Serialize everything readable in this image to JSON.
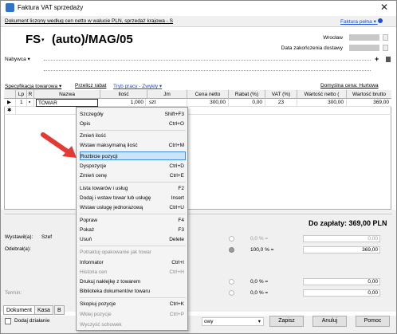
{
  "window": {
    "title": "Faktura VAT sprzedaży"
  },
  "subbar": {
    "doc_type": "Dokument liczony według cen netto w walucie PLN, sprzedaż krajowa - S",
    "full_invoice": "Faktura pełna"
  },
  "header": {
    "series": "FS",
    "number": "(auto)/MAG/05",
    "issue_place_label": "Wrocław",
    "delivery_date_label": "Data zakończenia dostawy",
    "buyer_label": "Nabywca"
  },
  "toolbar": {
    "spec": "Specyfikacja towarowa",
    "discount": "Przelicz rabat",
    "mode": "Tryb pracy - Zwykły",
    "default_price": "Domyślna cena: Hurtowa"
  },
  "grid": {
    "columns": [
      "Lp",
      "R",
      "Nazwa",
      "Ilość",
      "Jm",
      "Cena netto",
      "Rabat (%)",
      "VAT (%)",
      "Wartość netto (",
      "Wartość brutto"
    ],
    "row": {
      "nazwa": "TOWAR",
      "ilosc": "1,000",
      "jm": "szt",
      "cena": "300,00",
      "rabat": "0,00",
      "vat": "23",
      "netto": "300,00",
      "brutto": "369,00"
    }
  },
  "totals": {
    "to_pay": "Do zapłaty: 369,00 PLN"
  },
  "lower": {
    "issued_label": "Wystawił(a):",
    "issued_value": "Szef",
    "received_label": "Odebrał(a):",
    "term_label": "Termin:",
    "pct_zero": "0,0 % =",
    "pct_hundred": "100,0 % =",
    "amount_zero": "0,00",
    "amount_full": "369,00"
  },
  "tabs": [
    "Dokument",
    "Kasa",
    "B"
  ],
  "checkbox": {
    "add_action": "Dodaj działanie"
  },
  "combo": {
    "value": "owy"
  },
  "buttons": {
    "save": "Zapisz",
    "cancel": "Anuluj",
    "help": "Pomoc"
  },
  "context_menu": {
    "items": [
      {
        "label": "Szczegóły",
        "shortcut": "Shift+F3"
      },
      {
        "label": "Opis",
        "shortcut": "Ctrl+O"
      },
      {
        "label": "Zmień ilość",
        "shortcut": ""
      },
      {
        "label": "Wstaw maksymalną ilość",
        "shortcut": "Ctrl+M"
      },
      {
        "label": "Rozbicie pozycji",
        "shortcut": ""
      },
      {
        "label": "Dyspozycje",
        "shortcut": "Ctrl+D"
      },
      {
        "label": "Zmień cenę",
        "shortcut": "Ctrl+E"
      },
      {
        "label": "Lista towarów i usług",
        "shortcut": "F2"
      },
      {
        "label": "Dodaj i wstaw towar lub usługę",
        "shortcut": "Insert"
      },
      {
        "label": "Wstaw usługę jednorazową",
        "shortcut": "Ctrl+U"
      },
      {
        "label": "Popraw",
        "shortcut": "F4"
      },
      {
        "label": "Pokaż",
        "shortcut": "F3"
      },
      {
        "label": "Usuń",
        "shortcut": "Delete"
      },
      {
        "label": "Potraktuj opakowanie jak towar",
        "shortcut": ""
      },
      {
        "label": "Informator",
        "shortcut": "Ctrl+I"
      },
      {
        "label": "Historia cen",
        "shortcut": "Ctrl+H"
      },
      {
        "label": "Drukuj naklejkę z towarem",
        "shortcut": ""
      },
      {
        "label": "Biblioteka dokumentów towaru",
        "shortcut": ""
      },
      {
        "label": "Skopiuj pozycje",
        "shortcut": "Ctrl+K"
      },
      {
        "label": "Wklej pozycje",
        "shortcut": "Ctrl+P"
      },
      {
        "label": "Wyczyść schowek",
        "shortcut": ""
      }
    ]
  },
  "colors": {
    "accent": "#1a4fd6",
    "highlight": "#cce4f7",
    "arrow": "#e53935"
  }
}
